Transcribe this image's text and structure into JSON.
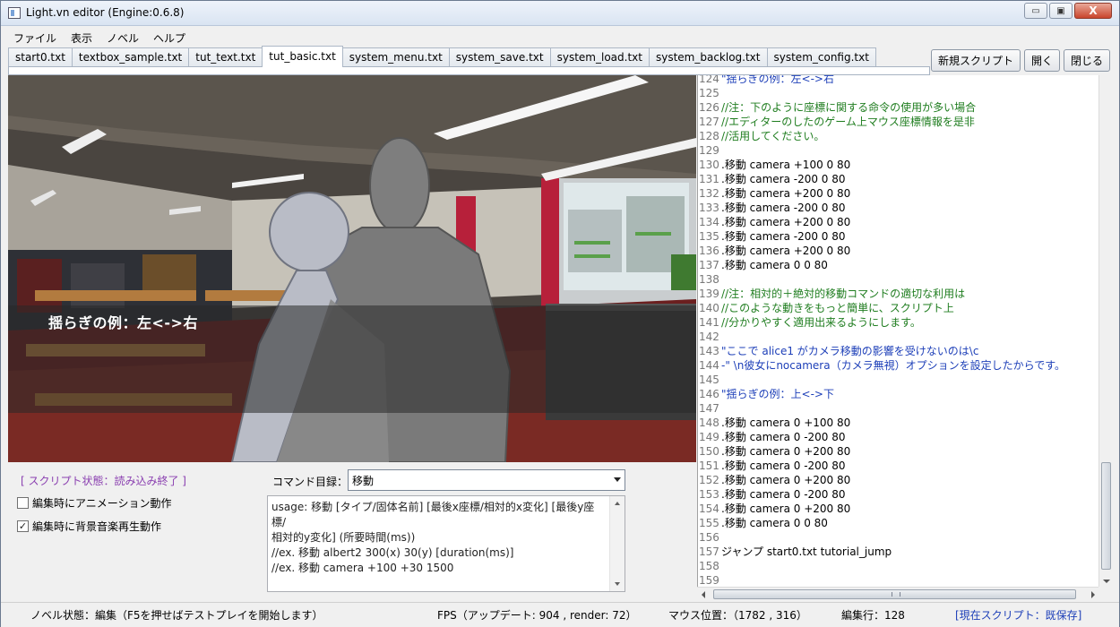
{
  "window": {
    "title": "Light.vn editor (Engine:0.6.8)",
    "min_glyph": "▭",
    "max_glyph": "▣",
    "close_glyph": "X"
  },
  "menu": [
    "ファイル",
    "表示",
    "ノベル",
    "ヘルプ"
  ],
  "tabs": [
    {
      "label": "start0.txt",
      "active": false
    },
    {
      "label": "textbox_sample.txt",
      "active": false
    },
    {
      "label": "tut_text.txt",
      "active": false
    },
    {
      "label": "tut_basic.txt",
      "active": true
    },
    {
      "label": "system_menu.txt",
      "active": false
    },
    {
      "label": "system_save.txt",
      "active": false
    },
    {
      "label": "system_load.txt",
      "active": false
    },
    {
      "label": "system_backlog.txt",
      "active": false
    },
    {
      "label": "system_config.txt",
      "active": false
    }
  ],
  "toolbar": {
    "new_script": "新規スクリプト",
    "open": "開く",
    "close": "閉じる"
  },
  "scene": {
    "dialog_text": "揺らぎの例：左<->右"
  },
  "panel": {
    "script_status": "[ スクリプト状態：読み込み終了 ]",
    "anim_checkbox": {
      "label": "編集時にアニメーション動作",
      "checked": false
    },
    "bgm_checkbox": {
      "label": "編集時に背景音楽再生動作",
      "checked": true
    },
    "check_glyph": "✓",
    "command_label": "コマンド目録：",
    "command_selected": "移動",
    "usage_lines": [
      "usage: 移動 [タイプ/固体名前] [最後x座標/相対的x変化] [最後y座標/",
      "相対的y変化] (所要時間(ms))",
      "//ex. 移動 albert2 300(x) 30(y) [duration(ms)]",
      "//ex. 移動 camera +100 +30 1500"
    ]
  },
  "editor": {
    "lines": [
      {
        "n": "124",
        "t": "\"揺らぎの例：左<->右",
        "c": "blue"
      },
      {
        "n": "125",
        "t": "",
        "c": ""
      },
      {
        "n": "126",
        "t": "//注：下のように座標に関する命令の使用が多い場合",
        "c": "green"
      },
      {
        "n": "127",
        "t": "//エディターのしたのゲーム上マウス座標情報を是非",
        "c": "green"
      },
      {
        "n": "128",
        "t": "//活用してください。",
        "c": "green"
      },
      {
        "n": "129",
        "t": "",
        "c": ""
      },
      {
        "n": "130",
        "t": ".移動 camera +100 0 80",
        "c": ""
      },
      {
        "n": "131",
        "t": ".移動 camera -200 0 80",
        "c": ""
      },
      {
        "n": "132",
        "t": ".移動 camera +200 0 80",
        "c": ""
      },
      {
        "n": "133",
        "t": ".移動 camera -200 0 80",
        "c": ""
      },
      {
        "n": "134",
        "t": ".移動 camera +200 0 80",
        "c": ""
      },
      {
        "n": "135",
        "t": ".移動 camera -200 0 80",
        "c": ""
      },
      {
        "n": "136",
        "t": ".移動 camera +200 0 80",
        "c": ""
      },
      {
        "n": "137",
        "t": ".移動 camera 0 0 80",
        "c": ""
      },
      {
        "n": "138",
        "t": "",
        "c": ""
      },
      {
        "n": "139",
        "t": "//注：相対的＋絶対的移動コマンドの適切な利用は",
        "c": "green"
      },
      {
        "n": "140",
        "t": "//このような動きをもっと簡単に、スクリプト上",
        "c": "green"
      },
      {
        "n": "141",
        "t": "//分かりやすく適用出来るようにします。",
        "c": "green"
      },
      {
        "n": "142",
        "t": "",
        "c": ""
      },
      {
        "n": "143",
        "t": "\"ここで alice1 がカメラ移動の影響を受けないのは\\c",
        "c": "blue"
      },
      {
        "n": "144",
        "t": "-\" \\n彼女にnocamera（カメラ無視）オプションを設定したからです。",
        "c": "blue"
      },
      {
        "n": "145",
        "t": "",
        "c": ""
      },
      {
        "n": "146",
        "t": "\"揺らぎの例：上<->下",
        "c": "blue"
      },
      {
        "n": "147",
        "t": "",
        "c": ""
      },
      {
        "n": "148",
        "t": ".移動 camera 0 +100 80",
        "c": ""
      },
      {
        "n": "149",
        "t": ".移動 camera 0 -200 80",
        "c": ""
      },
      {
        "n": "150",
        "t": ".移動 camera 0 +200 80",
        "c": ""
      },
      {
        "n": "151",
        "t": ".移動 camera 0 -200 80",
        "c": ""
      },
      {
        "n": "152",
        "t": ".移動 camera 0 +200 80",
        "c": ""
      },
      {
        "n": "153",
        "t": ".移動 camera 0 -200 80",
        "c": ""
      },
      {
        "n": "154",
        "t": ".移動 camera 0 +200 80",
        "c": ""
      },
      {
        "n": "155",
        "t": ".移動 camera 0 0 80",
        "c": ""
      },
      {
        "n": "156",
        "t": "",
        "c": ""
      },
      {
        "n": "157",
        "t": "ジャンプ start0.txt tutorial_jump",
        "c": ""
      },
      {
        "n": "158",
        "t": "",
        "c": ""
      },
      {
        "n": "159",
        "t": "",
        "c": ""
      }
    ]
  },
  "statusbar": {
    "novel_status": "ノベル状態：編集（F5を押せばテストプレイを開始します）",
    "fps": "FPS（アップデート: 904 , render: 72）",
    "mouse_pos": "マウス位置：（1782 , 316）",
    "edit_line": "編集行：128",
    "current_script": "[現在スクリプト：既保存]"
  },
  "colors": {
    "comment": "#1f7d1f",
    "string": "#1d3fb8",
    "status_purple": "#8a3fb0"
  }
}
